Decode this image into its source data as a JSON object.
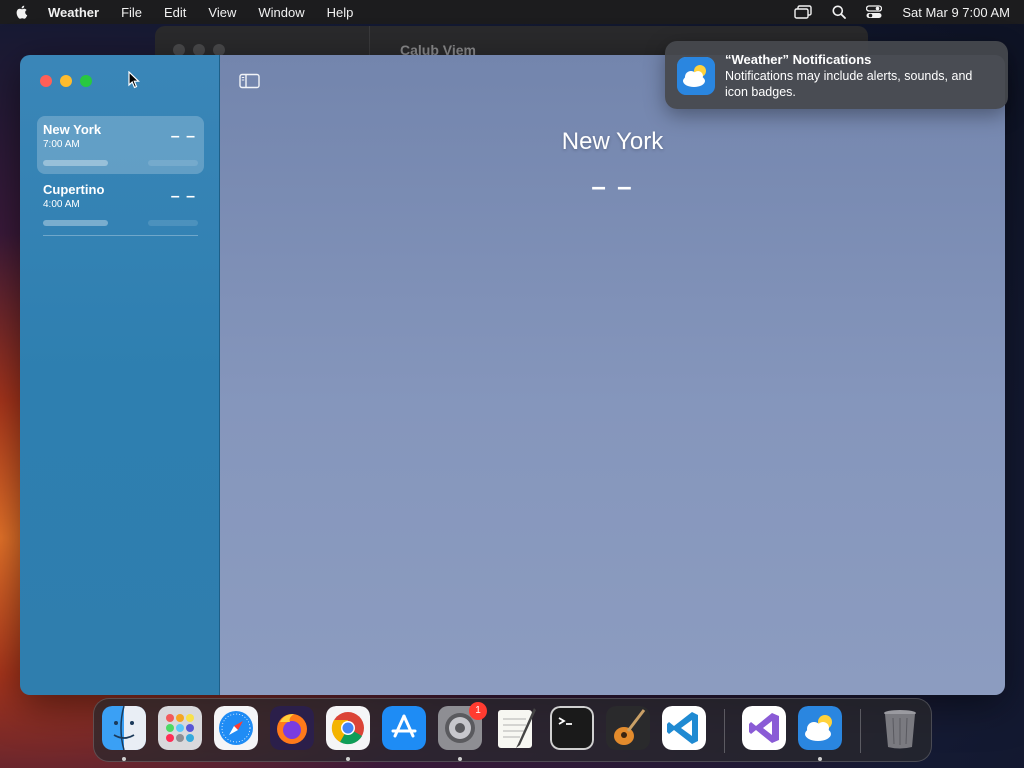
{
  "menubar": {
    "app_name": "Weather",
    "items": [
      "File",
      "Edit",
      "View",
      "Window",
      "Help"
    ],
    "clock": "Sat Mar 9  7:00 AM"
  },
  "background_window": {
    "title": "Calub Viem"
  },
  "sidebar": {
    "cities": [
      {
        "name": "New York",
        "time": "7:00 AM",
        "temp": "– –",
        "selected": true
      },
      {
        "name": "Cupertino",
        "time": "4:00 AM",
        "temp": "– –",
        "selected": false
      }
    ]
  },
  "main": {
    "city_title": "New York",
    "temperature": "– –"
  },
  "notification": {
    "title": "“Weather” Notifications",
    "body": "Notifications may include alerts, sounds, and icon badges."
  },
  "dock": {
    "apps": [
      {
        "name": "finder-icon",
        "running": true
      },
      {
        "name": "launchpad-icon",
        "running": false
      },
      {
        "name": "safari-icon",
        "running": false
      },
      {
        "name": "firefox-icon",
        "running": false
      },
      {
        "name": "chrome-icon",
        "running": true
      },
      {
        "name": "app-store-icon",
        "running": false
      },
      {
        "name": "system-settings-icon",
        "running": true,
        "badge": "1"
      },
      {
        "name": "textedit-icon",
        "running": false
      },
      {
        "name": "terminal-icon",
        "running": false
      },
      {
        "name": "garageband-icon",
        "running": false
      },
      {
        "name": "vscode-icon",
        "running": false
      },
      {
        "name": "visual-studio-icon",
        "running": false
      },
      {
        "name": "weather-icon",
        "running": true
      },
      {
        "name": "trash-icon",
        "running": false
      }
    ]
  },
  "colors": {
    "sidebar": "#2f7eae",
    "content": "#7f91b8",
    "notification_bg": "#46484e"
  }
}
